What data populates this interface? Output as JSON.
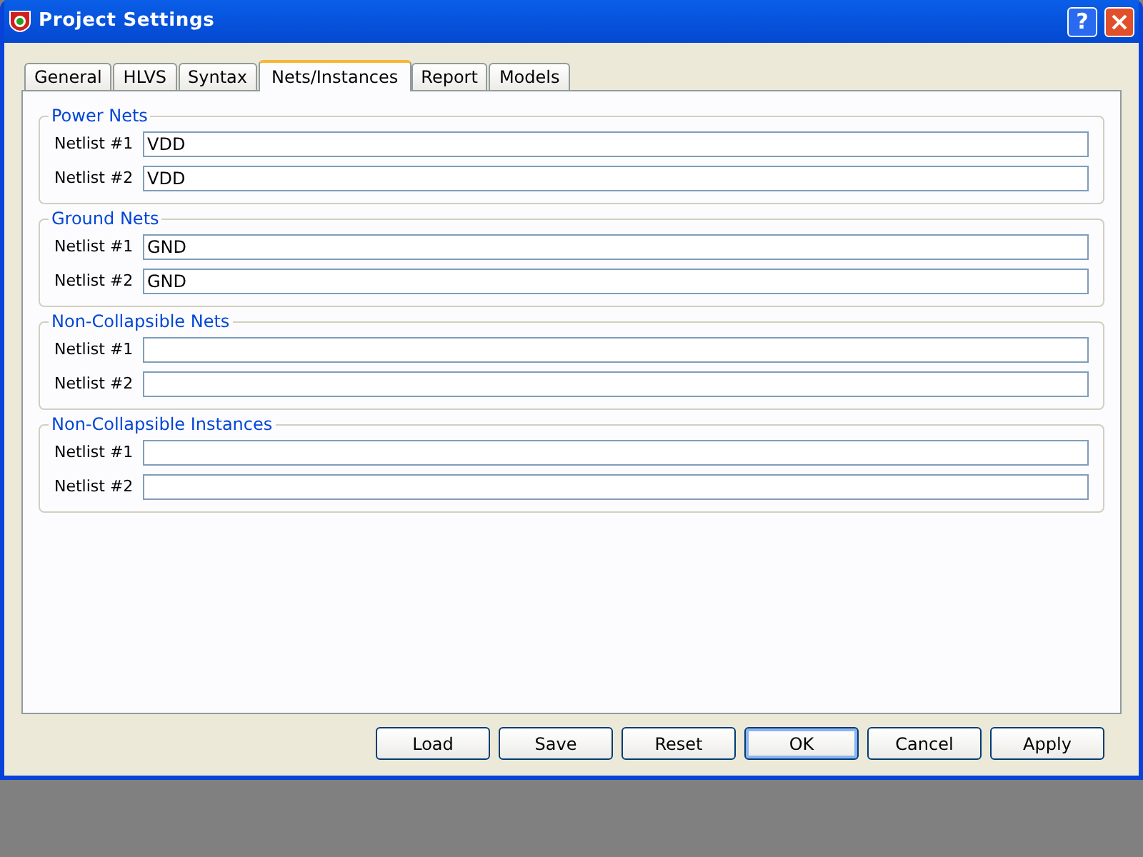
{
  "window": {
    "title": "Project Settings",
    "help": "?"
  },
  "tabs": [
    {
      "label": "General",
      "selected": false
    },
    {
      "label": "HLVS",
      "selected": false
    },
    {
      "label": "Syntax",
      "selected": false
    },
    {
      "label": "Nets/Instances",
      "selected": true
    },
    {
      "label": "Report",
      "selected": false
    },
    {
      "label": "Models",
      "selected": false
    }
  ],
  "groups": [
    {
      "title": "Power Nets",
      "fields": [
        {
          "label": "Netlist #1",
          "value": "VDD"
        },
        {
          "label": "Netlist #2",
          "value": "VDD"
        }
      ]
    },
    {
      "title": "Ground Nets",
      "fields": [
        {
          "label": "Netlist #1",
          "value": "GND"
        },
        {
          "label": "Netlist #2",
          "value": "GND"
        }
      ]
    },
    {
      "title": "Non-Collapsible Nets",
      "fields": [
        {
          "label": "Netlist #1"
        },
        {
          "label": "Netlist #2"
        }
      ]
    },
    {
      "title": "Non-Collapsible Instances",
      "fields": [
        {
          "label": "Netlist #1"
        },
        {
          "label": "Netlist #2"
        }
      ]
    }
  ],
  "buttons": [
    {
      "label": "Load",
      "default": false
    },
    {
      "label": "Save",
      "default": false
    },
    {
      "label": "Reset",
      "default": false
    },
    {
      "label": "OK",
      "default": true
    },
    {
      "label": "Cancel",
      "default": false
    },
    {
      "label": "Apply",
      "default": false
    }
  ]
}
